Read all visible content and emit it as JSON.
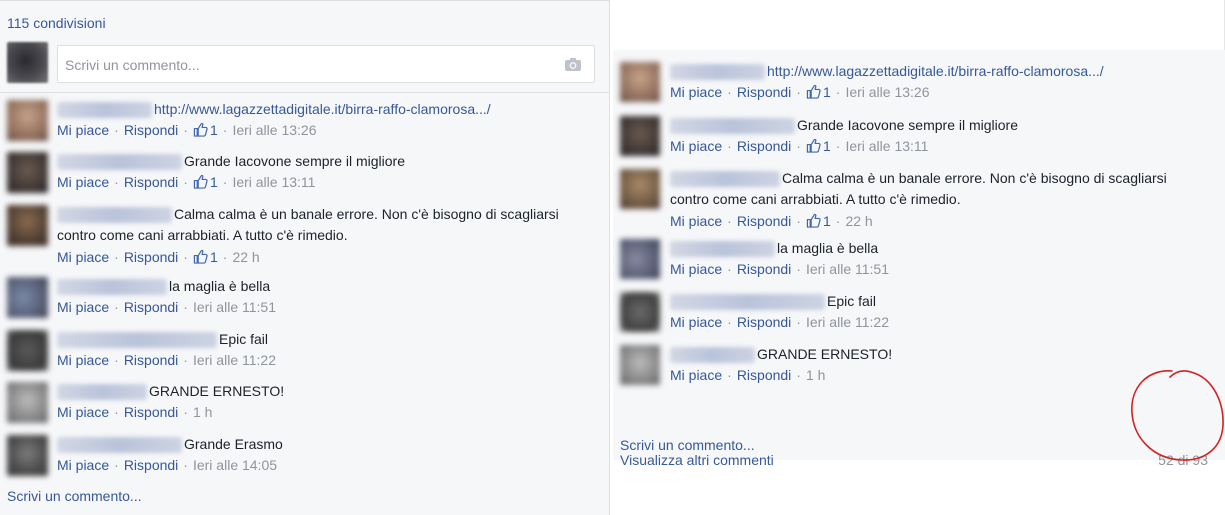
{
  "left": {
    "shares": "115 condivisioni",
    "composer_placeholder": "Scrivi un commento...",
    "write_comment": "Scrivi un commento...",
    "comments": [
      {
        "text": "http://www.lagazzettadigitale.it/birra-raffo-clamorosa.../",
        "is_link": true,
        "like": "Mi piace",
        "reply": "Rispondi",
        "likes": "1",
        "time": "Ieri alle 13:26"
      },
      {
        "text": "Grande Iacovone sempre il migliore",
        "like": "Mi piace",
        "reply": "Rispondi",
        "likes": "1",
        "time": "Ieri alle 13:11"
      },
      {
        "text": "Calma calma è un banale errore. Non c'è bisogno di scagliarsi",
        "text2": "contro come cani arrabbiati. A tutto c'è rimedio.",
        "like": "Mi piace",
        "reply": "Rispondi",
        "likes": "1",
        "time": "22 h"
      },
      {
        "text": "la maglia è bella",
        "like": "Mi piace",
        "reply": "Rispondi",
        "time": "Ieri alle 11:51"
      },
      {
        "text": "Epic fail",
        "like": "Mi piace",
        "reply": "Rispondi",
        "time": "Ieri alle 11:22"
      },
      {
        "text": "GRANDE ERNESTO!",
        "like": "Mi piace",
        "reply": "Rispondi",
        "time": "1 h"
      },
      {
        "text": "Grande Erasmo",
        "like": "Mi piace",
        "reply": "Rispondi",
        "time": "Ieri alle 14:05"
      }
    ]
  },
  "right": {
    "more_comments": "Visualizza altri commenti",
    "count": "52 di 93",
    "write_comment": "Scrivi un commento...",
    "comments": [
      {
        "text": "http://www.lagazzettadigitale.it/birra-raffo-clamorosa.../",
        "is_link": true,
        "like": "Mi piace",
        "reply": "Rispondi",
        "likes": "1",
        "time": "Ieri alle 13:26"
      },
      {
        "text": "Grande Iacovone sempre il migliore",
        "like": "Mi piace",
        "reply": "Rispondi",
        "likes": "1",
        "time": "Ieri alle 13:11"
      },
      {
        "text": "Calma calma è un banale errore. Non c'è bisogno di scagliarsi",
        "text2": "contro come cani arrabbiati. A tutto c'è rimedio.",
        "like": "Mi piace",
        "reply": "Rispondi",
        "likes": "1",
        "time": "22 h"
      },
      {
        "text": "la maglia è bella",
        "like": "Mi piace",
        "reply": "Rispondi",
        "time": "Ieri alle 11:51"
      },
      {
        "text": "Epic fail",
        "like": "Mi piace",
        "reply": "Rispondi",
        "time": "Ieri alle 11:22"
      },
      {
        "text": "GRANDE ERNESTO!",
        "like": "Mi piace",
        "reply": "Rispondi",
        "time": "1 h"
      }
    ]
  },
  "icons": {
    "camera": "camera-icon",
    "thumb": "thumbs-up-icon"
  },
  "colors": {
    "link": "#365899",
    "meta": "#90949c",
    "panel_bg": "#f6f7f9",
    "annotation": "#d42020"
  }
}
